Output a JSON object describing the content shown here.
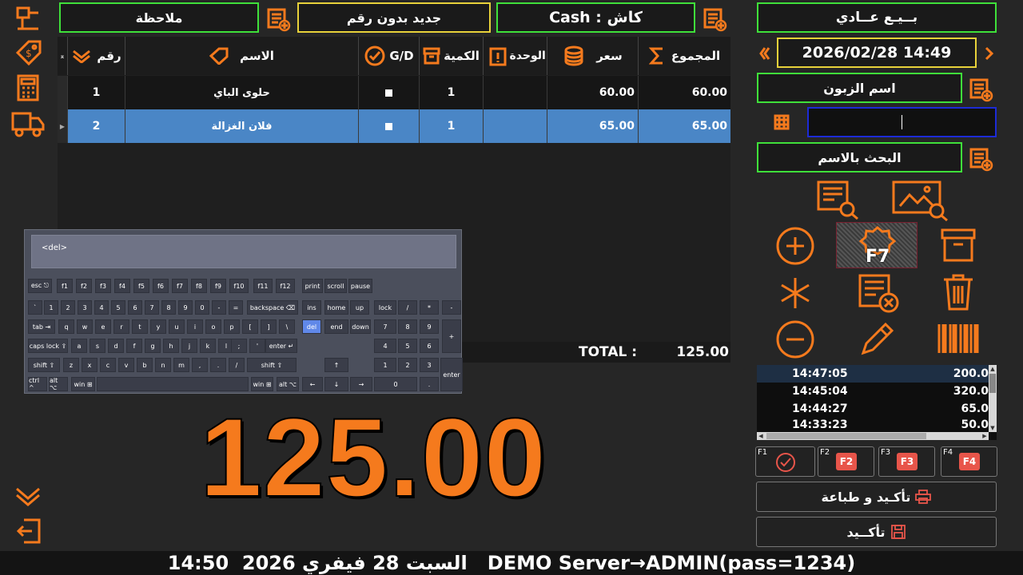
{
  "topbar": {
    "note_label": "ملاحظة",
    "new_no_number_label": "جديد بدون رقم",
    "payment_label": "Cash : كاش",
    "sale_type_label": "بــيـع عــادي"
  },
  "datetime": "2026/02/28 14:49",
  "customer": {
    "name_label": "اسم الزبون",
    "code_value": "",
    "search_by_name_label": "البحث بالاسم"
  },
  "table": {
    "headers": {
      "num": "رقم",
      "name": "الاسم",
      "gd": "G/D",
      "qty": "الكمية",
      "unit": "الوحدة",
      "price": "سعر",
      "total": "المجموع"
    },
    "rows": [
      {
        "num": "1",
        "name": "حلوى الباي",
        "qty": "1",
        "unit": "",
        "price": "60.00",
        "total": "60.00"
      },
      {
        "num": "2",
        "name": "فلان الغزالة",
        "qty": "1",
        "unit": "",
        "price": "65.00",
        "total": "65.00"
      }
    ],
    "total_label": "TOTAL :",
    "total_value": "125.00"
  },
  "big_total": "125.00",
  "keyboard": {
    "display_text": "<del>",
    "row1": [
      "esc ⎋",
      "f1",
      "f2",
      "f3",
      "f4",
      "f5",
      "f6",
      "f7",
      "f8",
      "f9",
      "f10",
      "f11",
      "f12",
      "print",
      "scroll",
      "pause"
    ],
    "row2": [
      "`",
      "1",
      "2",
      "3",
      "4",
      "5",
      "6",
      "7",
      "8",
      "9",
      "0",
      "-",
      "=",
      "backspace ⌫",
      "ins",
      "home",
      "up",
      "lock",
      "/",
      "*",
      "-"
    ],
    "row3": [
      "tab ⇥",
      "q",
      "w",
      "e",
      "r",
      "t",
      "y",
      "u",
      "i",
      "o",
      "p",
      "[",
      "]",
      "\\",
      "del",
      "end",
      "down",
      "7",
      "8",
      "9",
      "+"
    ],
    "row4": [
      "caps lock ⇪",
      "a",
      "s",
      "d",
      "f",
      "g",
      "h",
      "j",
      "k",
      "l",
      ";",
      "'",
      "enter ↵",
      "4",
      "5",
      "6"
    ],
    "row5": [
      "shift ⇧",
      "z",
      "x",
      "c",
      "v",
      "b",
      "n",
      "m",
      ",",
      ".",
      "/",
      "shift ⇧",
      "↑",
      "1",
      "2",
      "3",
      "enter"
    ],
    "row6": [
      "ctrl ^",
      "alt ⌥",
      "win ⊞",
      "",
      "win ⊞",
      "alt ⌥",
      "←",
      "↓",
      "→",
      "0",
      "."
    ]
  },
  "f7_label": "F7",
  "history": [
    {
      "time": "14:47:05",
      "amount": "200.0"
    },
    {
      "time": "14:45:04",
      "amount": "320.0"
    },
    {
      "time": "14:44:27",
      "amount": "65.0"
    },
    {
      "time": "14:33:23",
      "amount": "50.0"
    }
  ],
  "fkeys": [
    {
      "key": "F1",
      "badge": ""
    },
    {
      "key": "F2",
      "badge": "F2"
    },
    {
      "key": "F3",
      "badge": "F3"
    },
    {
      "key": "F4",
      "badge": "F4"
    }
  ],
  "confirm_print_label": "تأكـيد و طباعة",
  "confirm_label": "تأكــيد",
  "status_bar": "14:50  2026 السبت 28 فيفري   DEMO Server→ADMIN(pass=1234)",
  "colors": {
    "accent": "#f57a1d",
    "green_border": "#3fe03a",
    "yellow_border": "#e8d23a",
    "selected_row": "#4a86c6"
  }
}
